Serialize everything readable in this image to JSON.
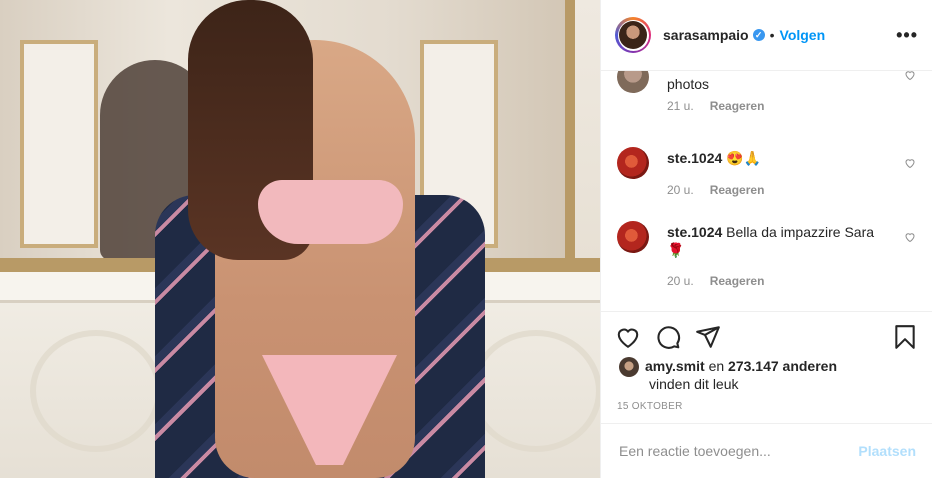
{
  "header": {
    "username": "sarasampaio",
    "verified_mark": "✓",
    "separator": "•",
    "follow_label": "Volgen",
    "more_label": "•••"
  },
  "comments": [
    {
      "text": "photos",
      "age": "21 u.",
      "reply_label": "Reageren"
    },
    {
      "username": "ste.1024",
      "text": "😍🙏",
      "age": "20 u.",
      "reply_label": "Reageren"
    },
    {
      "username": "ste.1024",
      "text": "Bella da impazzire Sara 🌹",
      "age": "20 u.",
      "reply_label": "Reageren"
    }
  ],
  "likes": {
    "user": "amy.smit",
    "connector": "en",
    "count": "273.147 anderen",
    "suffix": "vinden dit leuk"
  },
  "date": "15 OKTOBER",
  "add_comment": {
    "placeholder": "Een reactie toevoegen...",
    "post_label": "Plaatsen"
  },
  "colors": {
    "accent": "#0095f6",
    "post_disabled": "#b2dffc",
    "muted": "#8e8e8e"
  },
  "icons": [
    "heart-icon",
    "comment-icon",
    "share-icon",
    "bookmark-icon",
    "more-icon",
    "verified-icon"
  ]
}
